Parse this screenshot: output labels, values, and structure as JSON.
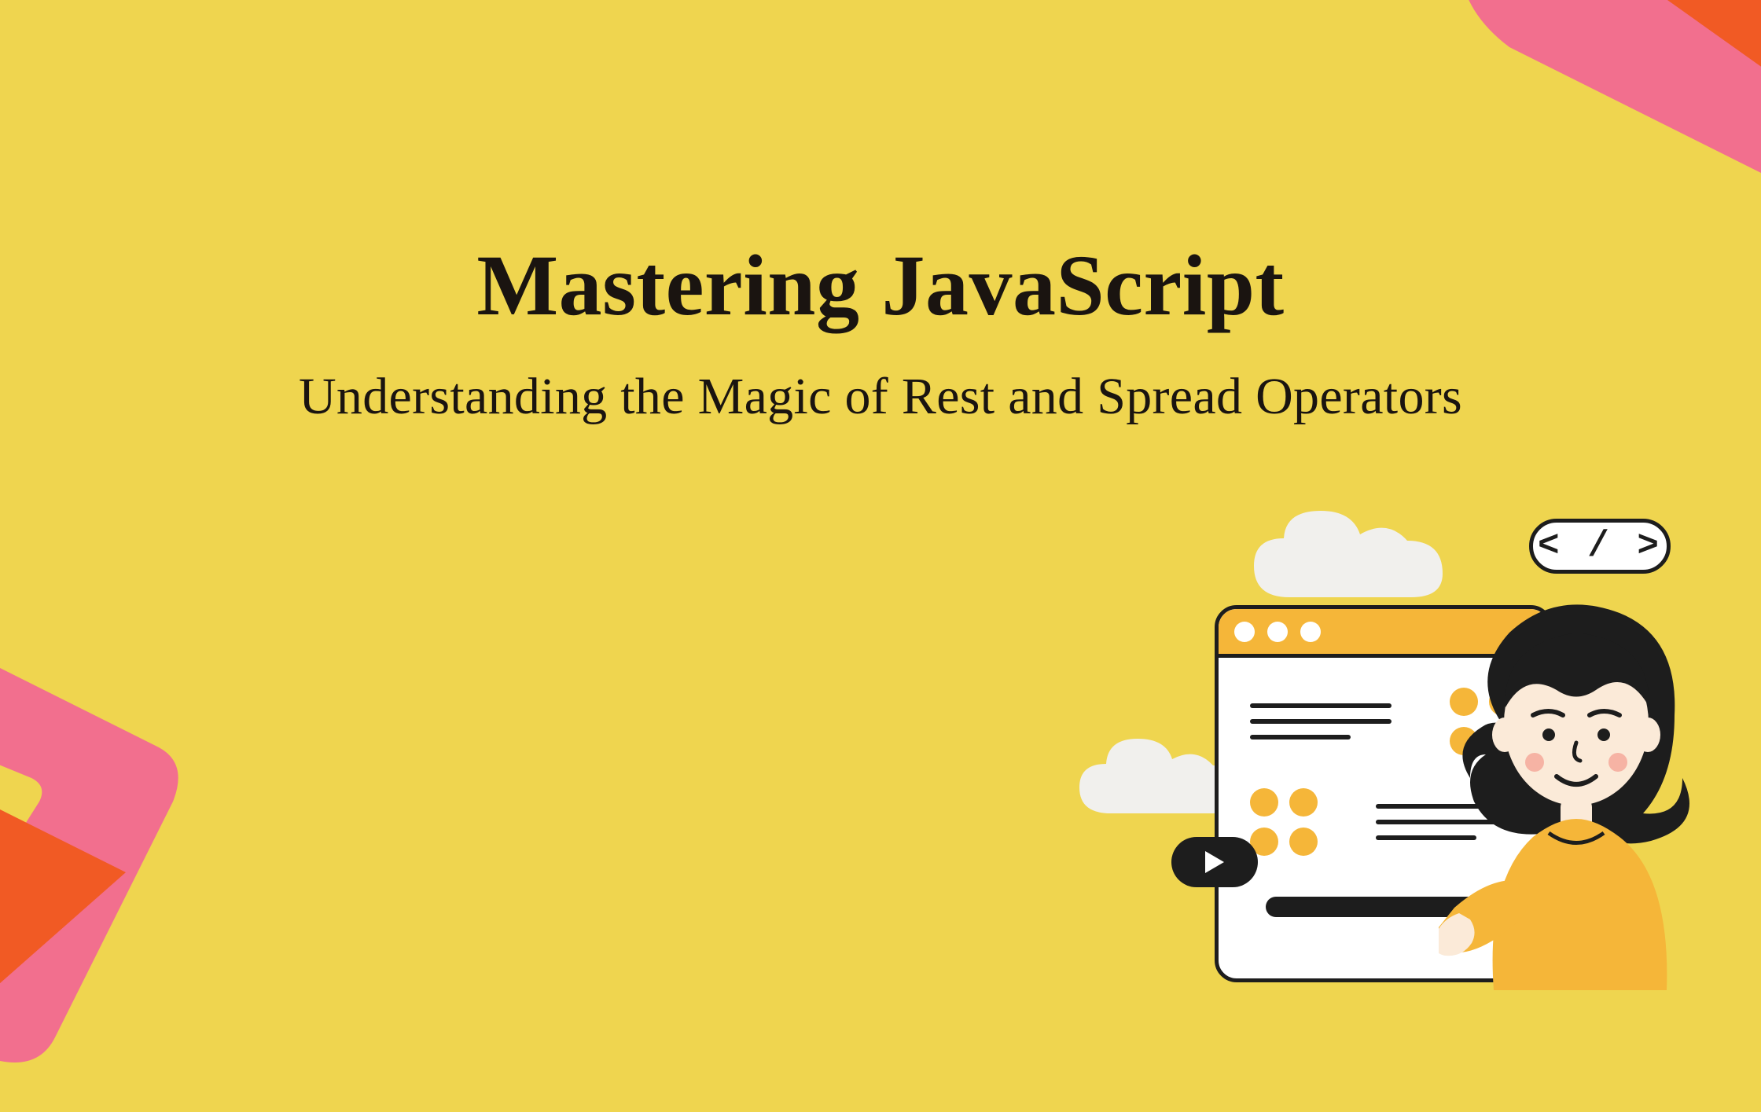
{
  "title": "Mastering JavaScript",
  "subtitle": "Understanding the Magic of Rest and Spread Operators",
  "code_badge": "< / >",
  "colors": {
    "background": "#efd54f",
    "accent_orange": "#f15a24",
    "accent_pink": "#f26f8e",
    "accent_yellow": "#f5b639",
    "text": "#1a1410",
    "white": "#ffffff",
    "dark": "#1d1d1d",
    "cloud": "#f1f0ed"
  }
}
